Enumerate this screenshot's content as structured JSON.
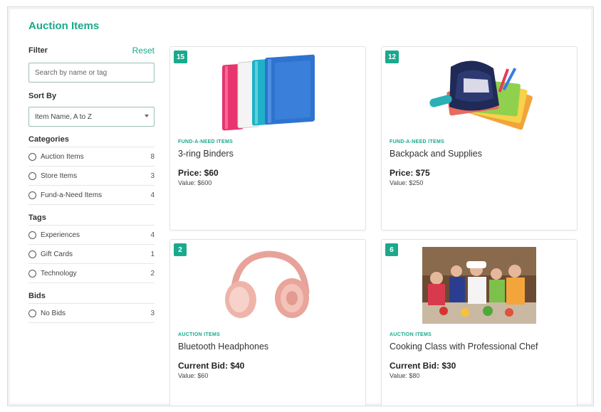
{
  "page": {
    "title": "Auction Items"
  },
  "filter": {
    "label": "Filter",
    "reset": "Reset",
    "search_placeholder": "Search by name or tag"
  },
  "sort": {
    "label": "Sort By",
    "selected": "Item Name, A to Z"
  },
  "categories": {
    "title": "Categories",
    "items": [
      {
        "label": "Auction Items",
        "count": "8"
      },
      {
        "label": "Store Items",
        "count": "3"
      },
      {
        "label": "Fund-a-Need Items",
        "count": "4"
      }
    ]
  },
  "tags": {
    "title": "Tags",
    "items": [
      {
        "label": "Experiences",
        "count": "4"
      },
      {
        "label": "Gift Cards",
        "count": "1"
      },
      {
        "label": "Technology",
        "count": "2"
      }
    ]
  },
  "bids": {
    "title": "Bids",
    "items": [
      {
        "label": "No Bids",
        "count": "3"
      }
    ]
  },
  "cards": [
    {
      "badge": "15",
      "category": "FUND-A-NEED ITEMS",
      "name": "3-ring Binders",
      "price": "Price: $60",
      "value": "Value: $600",
      "image_icon": "binders-image"
    },
    {
      "badge": "12",
      "category": "FUND-A-NEED ITEMS",
      "name": "Backpack and Supplies",
      "price": "Price: $75",
      "value": "Value: $250",
      "image_icon": "backpack-image"
    },
    {
      "badge": "2",
      "category": "AUCTION ITEMS",
      "name": "Bluetooth Headphones",
      "price": "Current Bid: $40",
      "value": "Value: $60",
      "image_icon": "headphones-image"
    },
    {
      "badge": "6",
      "category": "AUCTION ITEMS",
      "name": "Cooking Class with Professional Chef",
      "price": "Current Bid: $30",
      "value": "Value: $80",
      "image_icon": "cooking-class-image"
    }
  ],
  "colors": {
    "accent": "#18a98a",
    "badge": "#1aa98d"
  }
}
